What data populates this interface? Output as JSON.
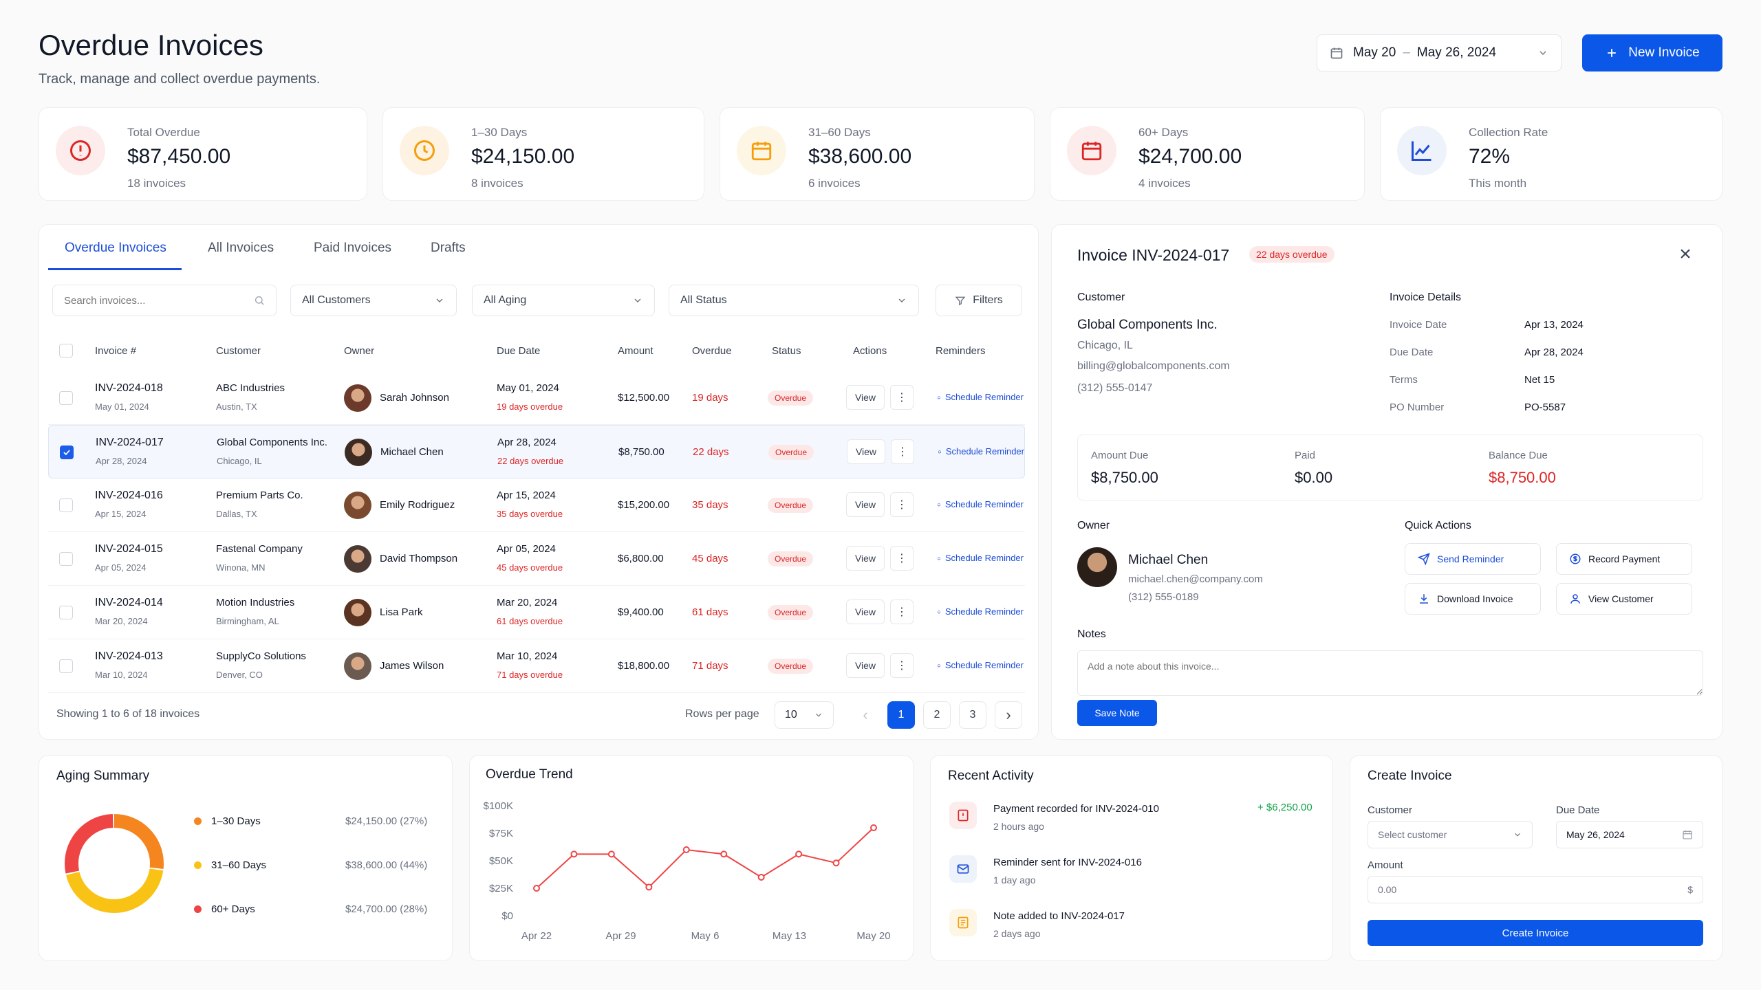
{
  "header": {
    "title": "Overdue Invoices",
    "subtitle": "Track, manage and collect overdue payments.",
    "date_start": "May 20",
    "date_sep": "–",
    "date_end": "May 26, 2024",
    "new_invoice": "New Invoice"
  },
  "stats": [
    {
      "label": "Total Overdue",
      "value": "$87,450.00",
      "count": "18 invoices",
      "icon": "alert-circle-icon",
      "color": "#dc2626",
      "bg": "#fdecec"
    },
    {
      "label": "1–30 Days",
      "value": "$24,150.00",
      "count": "8 invoices",
      "icon": "clock-icon",
      "color": "#f59e0b",
      "bg": "#fef3e2"
    },
    {
      "label": "31–60 Days",
      "value": "$38,600.00",
      "count": "6 invoices",
      "icon": "calendar-icon",
      "color": "#f59e0b",
      "bg": "#fef6e4"
    },
    {
      "label": "60+ Days",
      "value": "$24,700.00",
      "count": "4 invoices",
      "icon": "calendar-icon",
      "color": "#dc2626",
      "bg": "#fdecec"
    },
    {
      "label": "Collection Rate",
      "value": "72%",
      "count": "This month",
      "icon": "trend-up-icon",
      "color": "#1d4ed8",
      "bg": "#eef2fb"
    }
  ],
  "tabs": [
    "Overdue Invoices",
    "All Invoices",
    "Paid Invoices",
    "Drafts"
  ],
  "filters": {
    "search_placeholder": "Search invoices...",
    "customers": "All Customers",
    "aging": "All Aging",
    "status": "All Status",
    "filters": "Filters"
  },
  "table": {
    "headers": [
      "Invoice #",
      "Customer",
      "Owner",
      "Due Date",
      "Amount",
      "Overdue",
      "Status",
      "Actions",
      "Reminders"
    ],
    "view_label": "View",
    "dots": "⋮",
    "reminder_label": "Schedule Reminder",
    "rows": [
      {
        "id": "INV-2024-018",
        "issued": "May 01, 2024",
        "customer": "ABC Industries",
        "city": "Austin, TX",
        "owner": "Sarah Johnson",
        "due": "May 01, 2024",
        "due_note": "19 days overdue",
        "amount": "$12,500.00",
        "overdue": "19 days",
        "status": "Overdue",
        "selected": false,
        "av": "#6b3a2a"
      },
      {
        "id": "INV-2024-017",
        "issued": "Apr 28, 2024",
        "customer": "Global Components Inc.",
        "city": "Chicago, IL",
        "owner": "Michael Chen",
        "due": "Apr 28, 2024",
        "due_note": "22 days overdue",
        "amount": "$8,750.00",
        "overdue": "22 days",
        "status": "Overdue",
        "selected": true,
        "av": "#3b2b22"
      },
      {
        "id": "INV-2024-016",
        "issued": "Apr 15, 2024",
        "customer": "Premium Parts Co.",
        "city": "Dallas, TX",
        "owner": "Emily Rodriguez",
        "due": "Apr 15, 2024",
        "due_note": "35 days overdue",
        "amount": "$15,200.00",
        "overdue": "35 days",
        "status": "Overdue",
        "selected": false,
        "av": "#7a4a2e"
      },
      {
        "id": "INV-2024-015",
        "issued": "Apr 05, 2024",
        "customer": "Fastenal Company",
        "city": "Winona, MN",
        "owner": "David Thompson",
        "due": "Apr 05, 2024",
        "due_note": "45 days overdue",
        "amount": "$6,800.00",
        "overdue": "45 days",
        "status": "Overdue",
        "selected": false,
        "av": "#4a3a33"
      },
      {
        "id": "INV-2024-014",
        "issued": "Mar 20, 2024",
        "customer": "Motion Industries",
        "city": "Birmingham, AL",
        "owner": "Lisa Park",
        "due": "Mar 20, 2024",
        "due_note": "61 days overdue",
        "amount": "$9,400.00",
        "overdue": "61 days",
        "status": "Overdue",
        "selected": false,
        "av": "#5a3322"
      },
      {
        "id": "INV-2024-013",
        "issued": "Mar 10, 2024",
        "customer": "SupplyCo Solutions",
        "city": "Denver, CO",
        "owner": "James Wilson",
        "due": "Mar 10, 2024",
        "due_note": "71 days overdue",
        "amount": "$18,800.00",
        "overdue": "71 days",
        "status": "Overdue",
        "selected": false,
        "av": "#6a5a50"
      }
    ]
  },
  "pagination": {
    "showing": "Showing 1 to 6 of 18 invoices",
    "rows_label": "Rows per page",
    "rows_value": "10",
    "pages": [
      "1",
      "2",
      "3"
    ],
    "prev": "‹",
    "next": "›"
  },
  "detail": {
    "title": "Invoice INV-2024-017",
    "badge": "22 days overdue",
    "close": "×",
    "customer_label": "Customer",
    "customer_name": "Global Components Inc.",
    "customer_city": "Chicago, IL",
    "customer_email": "billing@globalcomponents.com",
    "customer_phone": "(312) 555-0147",
    "details_label": "Invoice Details",
    "details": [
      {
        "k": "Invoice Date",
        "v": "Apr 13, 2024"
      },
      {
        "k": "Due Date",
        "v": "Apr 28, 2024"
      },
      {
        "k": "Terms",
        "v": "Net 15"
      },
      {
        "k": "PO Number",
        "v": "PO-5587"
      }
    ],
    "amount_due_label": "Amount Due",
    "amount_due": "$8,750.00",
    "paid_label": "Paid",
    "paid": "$0.00",
    "balance_label": "Balance Due",
    "balance": "$8,750.00",
    "owner_label": "Owner",
    "owner_name": "Michael Chen",
    "owner_email": "michael.chen@company.com",
    "owner_phone": "(312) 555-0189",
    "quick_label": "Quick Actions",
    "send_reminder": "Send Reminder",
    "record_payment": "Record Payment",
    "download": "Download Invoice",
    "view_customer": "View Customer",
    "notes_label": "Notes",
    "notes_placeholder": "Add a note about this invoice...",
    "save_note": "Save Note"
  },
  "aging": {
    "title": "Aging Summary",
    "items": [
      {
        "label": "1–30 Days",
        "value": "$24,150.00 (27%)",
        "pct": 27,
        "color": "#f5851f"
      },
      {
        "label": "31–60 Days",
        "value": "$38,600.00 (44%)",
        "pct": 44,
        "color": "#f9c315"
      },
      {
        "label": "60+ Days",
        "value": "$24,700.00 (28%)",
        "pct": 28,
        "color": "#ef4444"
      }
    ]
  },
  "chart_data": {
    "type": "line",
    "title": "Overdue Trend",
    "x_ticks": [
      "Apr 22",
      "Apr 29",
      "May 6",
      "May 13",
      "May 20"
    ],
    "y_ticks": [
      "$100K",
      "$75K",
      "$50K",
      "$25K",
      "$0"
    ],
    "ylim": [
      0,
      100000
    ],
    "values": [
      25000,
      56000,
      56000,
      26000,
      60000,
      56000,
      35000,
      56000,
      48000,
      80000
    ],
    "color": "#ef4444",
    "grid": false
  },
  "activity": {
    "title": "Recent Activity",
    "items": [
      {
        "text": "Payment recorded for INV-2024-010",
        "time": "2 hours ago",
        "amount": "+ $6,250.00",
        "icon": "payment-icon",
        "color": "#dc2626",
        "bg": "#fdecec"
      },
      {
        "text": "Reminder sent for INV-2024-016",
        "time": "1 day ago",
        "amount": "",
        "icon": "mail-icon",
        "color": "#1d4ed8",
        "bg": "#eef2fb"
      },
      {
        "text": "Note added to INV-2024-017",
        "time": "2 days ago",
        "amount": "",
        "icon": "note-icon",
        "color": "#f59e0b",
        "bg": "#fef6e4"
      }
    ]
  },
  "create": {
    "title": "Create Invoice",
    "customer_label": "Customer",
    "customer_placeholder": "Select customer",
    "due_label": "Due Date",
    "due_value": "May 26, 2024",
    "amount_label": "Amount",
    "amount_value": "0.00",
    "currency": "$",
    "button": "Create Invoice"
  }
}
